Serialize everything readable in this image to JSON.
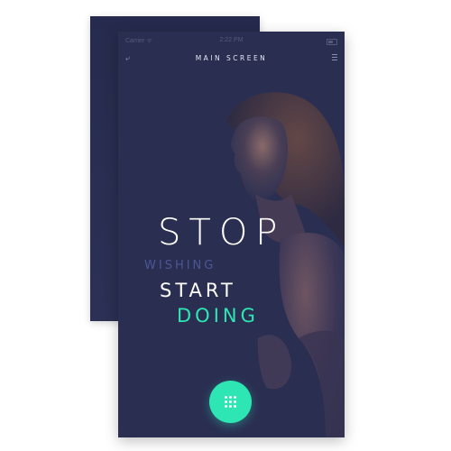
{
  "status_bar": {
    "carrier": "Carrier ᯤ",
    "time": "2:22 PM"
  },
  "nav": {
    "back_icon": "back-arrow-icon",
    "title": "MAIN SCREEN",
    "menu_icon": "hamburger-menu-icon"
  },
  "headline": {
    "line1": "STOP",
    "line2": "WISHING",
    "line3": "START",
    "line4": "DOING"
  },
  "fab": {
    "icon": "grid-dots-icon"
  },
  "colors": {
    "background": "#2a2f52",
    "accent": "#2ee6b4",
    "muted_text": "#4c5694",
    "headline_text": "#ffffff"
  }
}
